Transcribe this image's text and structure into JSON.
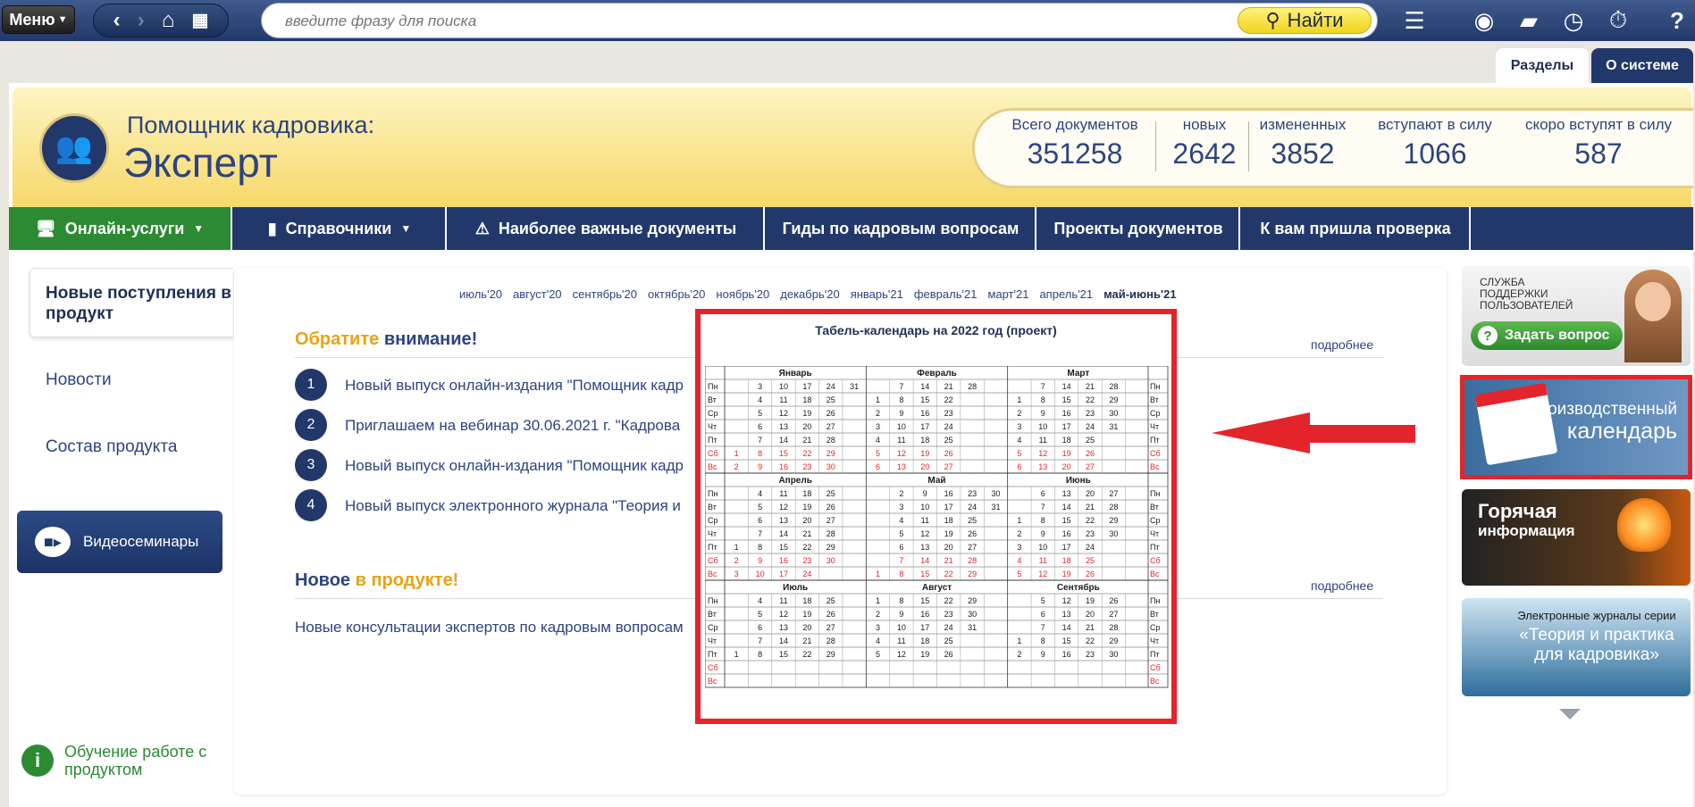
{
  "topbar": {
    "menu_label": "Меню",
    "search_placeholder": "введите фразу для поиска",
    "find_label": "Найти",
    "icons": [
      "chevron-left-icon",
      "chevron-right-icon",
      "home-icon",
      "grid-icon",
      "list-icon",
      "user-icon",
      "folder-icon",
      "clock-icon",
      "stopwatch-icon",
      "help-icon"
    ]
  },
  "tabs": {
    "sections": "Разделы",
    "about": "О системе"
  },
  "product": {
    "subtitle": "Помощник кадровика:",
    "title": "Эксперт"
  },
  "stats": [
    {
      "label": "Всего документов",
      "value": "351258"
    },
    {
      "label": "новых",
      "value": "2642"
    },
    {
      "label": "измененных",
      "value": "3852"
    },
    {
      "label": "вступают в силу",
      "value": "1066"
    },
    {
      "label": "скоро вступят в силу",
      "value": "587"
    }
  ],
  "nav": [
    {
      "label": "Онлайн-услуги"
    },
    {
      "label": "Справочники"
    },
    {
      "label": "Наиболее важные документы"
    },
    {
      "label": "Гиды по кадровым вопросам"
    },
    {
      "label": "Проекты документов"
    },
    {
      "label": "К вам пришла проверка"
    }
  ],
  "sidebar": {
    "active": "Новые поступления в продукт",
    "links": [
      "Новости",
      "Состав продукта"
    ],
    "video": "Видеосеминары",
    "learn": "Обучение работе с продуктом"
  },
  "months": [
    "июль'20",
    "август'20",
    "сентябрь'20",
    "октябрь'20",
    "ноябрь'20",
    "декабрь'20",
    "январь'21",
    "февраль'21",
    "март'21",
    "апрель'21",
    "май-июнь'21"
  ],
  "attention": {
    "part1": "Обратите",
    "part2": "внимание!",
    "more": "подробнее"
  },
  "news": [
    {
      "n": "1",
      "text": "Новый выпуск онлайн-издания \"Помощник кадр"
    },
    {
      "n": "2",
      "text": "Приглашаем на вебинар 30.06.2021 г. \"Кадрова"
    },
    {
      "n": "3",
      "text": "Новый выпуск онлайн-издания \"Помощник кадр"
    },
    {
      "n": "4",
      "text": "Новый выпуск электронного журнала \"Теория и"
    }
  ],
  "new_in_product": {
    "part1": "Новое",
    "part2": "в продукте!",
    "more": "подробнее",
    "text": "Новые консультации экспертов по кадровым вопросам"
  },
  "calendar": {
    "title": "Табель-календарь на 2022 год (проект)",
    "days": [
      "Пн",
      "Вт",
      "Ср",
      "Чт",
      "Пт",
      "Сб",
      "Вс"
    ],
    "quarters": [
      {
        "months": [
          {
            "name": "Январь",
            "cols": [
              [
                "",
                "",
                "",
                "",
                "",
                "1",
                "2"
              ],
              [
                "3",
                "4",
                "5",
                "6",
                "7",
                "8",
                "9"
              ],
              [
                "10",
                "11",
                "12",
                "13",
                "14",
                "15",
                "16"
              ],
              [
                "17",
                "18",
                "19",
                "20",
                "21",
                "22",
                "23"
              ],
              [
                "24",
                "25",
                "26",
                "27",
                "28",
                "29",
                "30"
              ],
              [
                "31",
                "",
                "",
                "",
                "",
                "",
                ""
              ]
            ]
          },
          {
            "name": "Февраль",
            "cols": [
              [
                "",
                "1",
                "2",
                "3",
                "4",
                "5",
                "6"
              ],
              [
                "7",
                "8",
                "9",
                "10",
                "11",
                "12",
                "13"
              ],
              [
                "14",
                "15",
                "16",
                "17",
                "18",
                "19",
                "20"
              ],
              [
                "21",
                "22",
                "23",
                "24",
                "25",
                "26",
                "27"
              ],
              [
                "28",
                "",
                "",
                "",
                "",
                "",
                ""
              ]
            ]
          },
          {
            "name": "Март",
            "cols": [
              [
                "",
                "1",
                "2",
                "3",
                "4",
                "5",
                "6"
              ],
              [
                "7",
                "8",
                "9",
                "10",
                "11",
                "12",
                "13"
              ],
              [
                "14",
                "15",
                "16",
                "17",
                "18",
                "19",
                "20"
              ],
              [
                "21",
                "22",
                "23",
                "24",
                "25",
                "26",
                "27"
              ],
              [
                "28",
                "29",
                "30",
                "31",
                "",
                "",
                ""
              ]
            ]
          }
        ]
      },
      {
        "months": [
          {
            "name": "Апрель",
            "cols": [
              [
                "",
                "",
                "",
                "",
                "1",
                "2",
                "3"
              ],
              [
                "4",
                "5",
                "6",
                "7",
                "8",
                "9",
                "10"
              ],
              [
                "11",
                "12",
                "13",
                "14",
                "15",
                "16",
                "17"
              ],
              [
                "18",
                "19",
                "20",
                "21",
                "22",
                "23",
                "24"
              ],
              [
                "25",
                "26",
                "27",
                "28",
                "29",
                "30",
                ""
              ]
            ]
          },
          {
            "name": "Май",
            "cols": [
              [
                "",
                "",
                "",
                "",
                "",
                "",
                "1"
              ],
              [
                "2",
                "3",
                "4",
                "5",
                "6",
                "7",
                "8"
              ],
              [
                "9",
                "10",
                "11",
                "12",
                "13",
                "14",
                "15"
              ],
              [
                "16",
                "17",
                "18",
                "19",
                "20",
                "21",
                "22"
              ],
              [
                "23",
                "24",
                "25",
                "26",
                "27",
                "28",
                "29"
              ],
              [
                "30",
                "31",
                "",
                "",
                "",
                "",
                ""
              ]
            ]
          },
          {
            "name": "Июнь",
            "cols": [
              [
                "",
                "",
                "1",
                "2",
                "3",
                "4",
                "5"
              ],
              [
                "6",
                "7",
                "8",
                "9",
                "10",
                "11",
                "12"
              ],
              [
                "13",
                "14",
                "15",
                "16",
                "17",
                "18",
                "19"
              ],
              [
                "20",
                "21",
                "22",
                "23",
                "24",
                "25",
                "26"
              ],
              [
                "27",
                "28",
                "29",
                "30",
                "",
                "",
                ""
              ]
            ]
          }
        ]
      },
      {
        "months": [
          {
            "name": "Июль",
            "cols": [
              [
                "",
                "",
                "",
                "",
                "1",
                "",
                ""
              ],
              [
                "4",
                "5",
                "6",
                "7",
                "8",
                "",
                ""
              ],
              [
                "11",
                "12",
                "13",
                "14",
                "15",
                "",
                ""
              ],
              [
                "18",
                "19",
                "20",
                "21",
                "22",
                "",
                ""
              ],
              [
                "25",
                "26",
                "27",
                "28",
                "29",
                "",
                ""
              ]
            ]
          },
          {
            "name": "Август",
            "cols": [
              [
                "1",
                "2",
                "3",
                "4",
                "5",
                "",
                ""
              ],
              [
                "8",
                "9",
                "10",
                "11",
                "12",
                "",
                ""
              ],
              [
                "15",
                "16",
                "17",
                "18",
                "19",
                "",
                ""
              ],
              [
                "22",
                "23",
                "24",
                "25",
                "26",
                "",
                ""
              ],
              [
                "29",
                "30",
                "31",
                "",
                "",
                "",
                ""
              ]
            ]
          },
          {
            "name": "Сентябрь",
            "cols": [
              [
                "",
                "",
                "",
                "1",
                "2",
                "",
                ""
              ],
              [
                "5",
                "6",
                "7",
                "8",
                "9",
                "",
                ""
              ],
              [
                "12",
                "13",
                "14",
                "15",
                "16",
                "",
                ""
              ],
              [
                "19",
                "20",
                "21",
                "22",
                "23",
                "",
                ""
              ],
              [
                "26",
                "27",
                "28",
                "29",
                "30",
                "",
                ""
              ]
            ]
          }
        ]
      }
    ],
    "holiday_color": "#e3242b",
    "text_color": "#1a1a1a"
  },
  "banners": {
    "support": "СЛУЖБА ПОДДЕРЖКИ ПОЛЬЗОВАТЕЛЕЙ",
    "ask": "Задать вопрос",
    "prodcal_1": "Производственный",
    "prodcal_2": "календарь",
    "hot_1": "Горячая",
    "hot_2": "информация",
    "journals_1": "Электронные журналы серии",
    "journals_2": "«Теория и практика для кадровика»"
  },
  "colors": {
    "brand": "#22386a",
    "accent": "#e8a215",
    "green": "#2b8a32",
    "highlight": "#e3242b"
  }
}
